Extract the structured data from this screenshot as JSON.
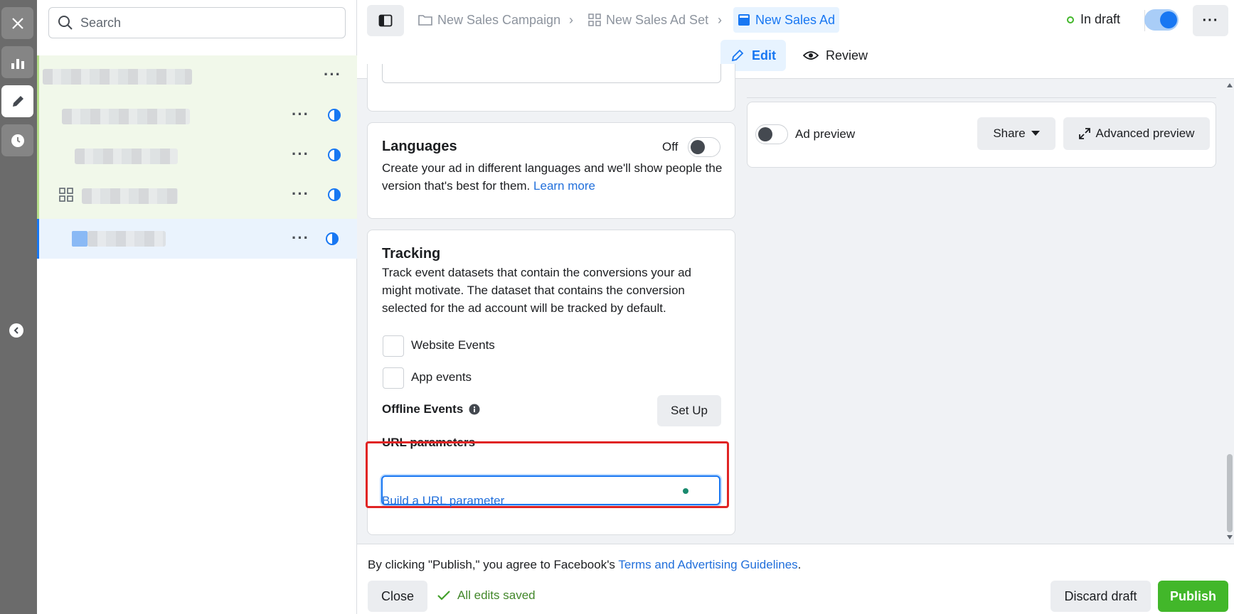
{
  "search": {
    "placeholder": "Search"
  },
  "breadcrumb": {
    "campaign": "New Sales Campaign",
    "adset": "New Sales Ad Set",
    "ad": "New Sales Ad"
  },
  "status": {
    "label": "In draft"
  },
  "modes": {
    "edit": "Edit",
    "review": "Review"
  },
  "languages": {
    "title": "Languages",
    "toggle_label": "Off",
    "description": "Create your ad in different languages and we'll show people the version that's best for them.",
    "learn_more": "Learn more"
  },
  "tracking": {
    "title": "Tracking",
    "description": "Track event datasets that contain the conversions your ad might motivate. The dataset that contains the conversion selected for the ad account will be tracked by default.",
    "website_events": "Website Events",
    "app_events": "App events",
    "offline_events": "Offline Events",
    "setup_button": "Set Up",
    "url_parameters_label": "URL parameters",
    "url_parameters_value": "",
    "build_link": "Build a URL parameter"
  },
  "preview": {
    "ad_preview_label": "Ad preview",
    "share_button": "Share",
    "advanced_preview_button": "Advanced preview"
  },
  "footer": {
    "agreement_prefix": "By clicking \"Publish,\" you agree to Facebook's",
    "agreement_link": "Terms and Advertising Guidelines",
    "agreement_suffix": ".",
    "close_button": "Close",
    "saved_status": "All edits saved",
    "discard_button": "Discard draft",
    "publish_button": "Publish"
  },
  "colors": {
    "accent": "#1877f2",
    "publish": "#42b72a",
    "highlight": "#e02424"
  }
}
